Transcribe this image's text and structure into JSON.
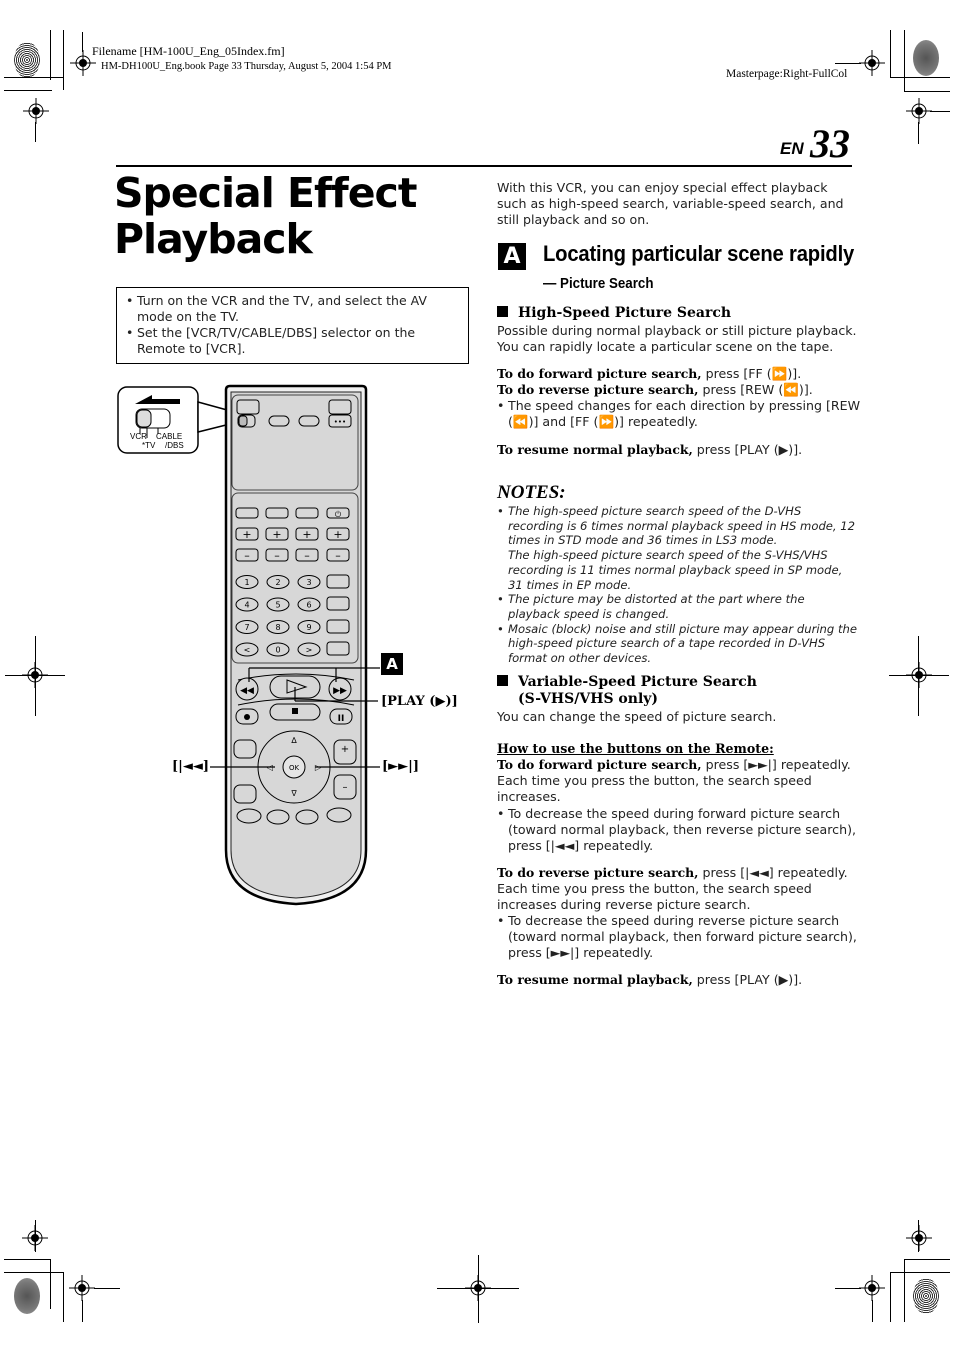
{
  "header": {
    "filename": "Filename [HM-100U_Eng_05Index.fm]",
    "book_info": "HM-DH100U_Eng.book  Page 33  Thursday, August 5, 2004  1:54 PM",
    "masterpage": "Masterpage:Right-FullCol",
    "language_label": "EN",
    "page_number": "33"
  },
  "title": {
    "line1": "Special Effect",
    "line2": "Playback"
  },
  "prerequisites": [
    "Turn on the VCR and the TV, and select the AV mode on the TV.",
    "Set the [VCR/TV/CABLE/DBS] selector on the Remote to [VCR]."
  ],
  "intro": "With this VCR, you can enjoy special effect playback such as high-speed search, variable-speed search, and still playback and so on.",
  "section_a": {
    "badge": "A",
    "title": "Locating particular scene rapidly",
    "subtitle": "— Picture Search"
  },
  "high_speed": {
    "heading": "High-Speed Picture Search",
    "desc": "Possible during normal playback or still picture playback. You can rapidly locate a particular scene on the tape.",
    "forward_label": "To do forward picture search,",
    "forward_text": " press [FF (⏩)].",
    "reverse_label": "To do reverse picture search,",
    "reverse_text": " press [REW (⏪)].",
    "bullet": "The speed changes for each direction by pressing [REW (⏪)] and [FF (⏩)] repeatedly.",
    "resume_label": "To resume normal playback,",
    "resume_text": " press [PLAY (▶)]."
  },
  "notes": {
    "heading": "NOTES:",
    "items": [
      "The high-speed picture search speed of the D-VHS recording is 6 times normal playback speed in HS mode, 12 times in STD mode and 36 times in LS3 mode.",
      "The high-speed picture search speed of the S-VHS/VHS recording is 11 times normal playback speed in SP mode, 31 times in EP mode.",
      "The picture may be distorted at the part where the playback speed is changed.",
      "Mosaic (block) noise and still picture may appear during the high-speed picture search of a tape recorded in D-VHS format on other devices."
    ]
  },
  "variable_speed": {
    "heading_line1": "Variable-Speed Picture Search",
    "heading_line2": "(S-VHS/VHS only)",
    "desc": "You can change the speed of picture search.",
    "howto": "How to use the buttons on the Remote:",
    "forward_label": "To do forward picture search,",
    "forward_text": " press [►►|] repeatedly. Each time you press the button, the search speed increases.",
    "forward_bullet": "To decrease the speed during forward picture search (toward normal playback, then reverse picture search), press [|◄◄] repeatedly.",
    "reverse_label": "To do reverse picture search,",
    "reverse_text": " press [|◄◄] repeatedly. Each time you press the button, the search speed increases during reverse picture search.",
    "reverse_bullet": "To decrease the speed during reverse picture search (toward normal playback, then forward picture search), press [►►|] repeatedly.",
    "resume_label": "To resume normal playback,",
    "resume_text": " press [PLAY (▶)]."
  },
  "remote": {
    "selector_labels": {
      "vcr": "VCR",
      "tv": "*TV",
      "cable": "CABLE",
      "dbs": "/DBS"
    },
    "number_keys": [
      "1",
      "2",
      "3",
      "4",
      "5",
      "6",
      "7",
      "8",
      "9",
      "<",
      "0",
      ">"
    ],
    "ok_label": "OK",
    "callouts": {
      "section_badge": "A",
      "play": "[PLAY (▶)]",
      "skip_back": "[|◄◄]",
      "skip_forward": "[►►|]"
    }
  }
}
